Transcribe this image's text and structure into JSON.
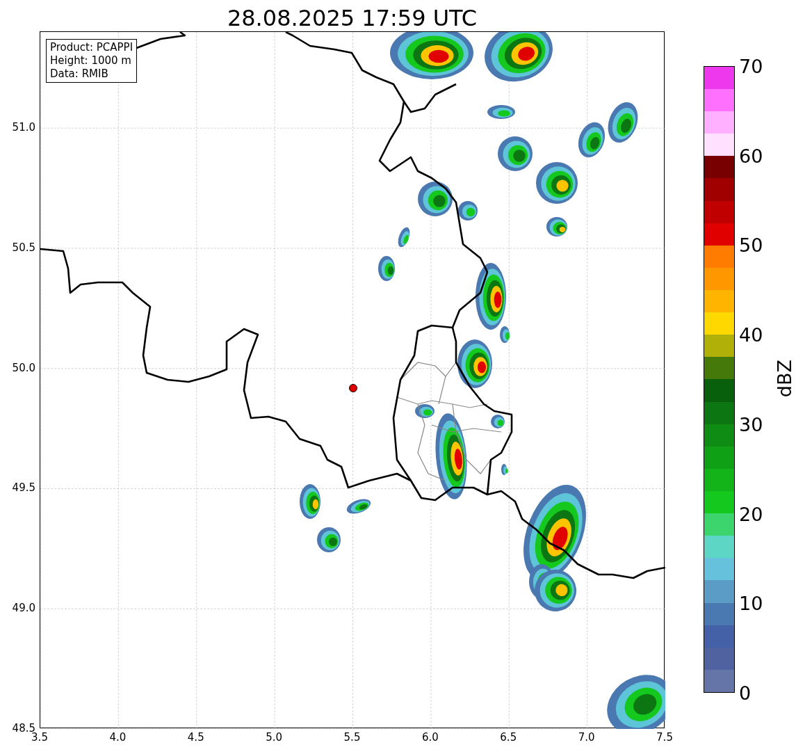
{
  "title": "28.08.2025 17:59 UTC",
  "info_box": [
    "Product: PCAPPI",
    "Height: 1000 m",
    "Data: RMIB"
  ],
  "map": {
    "xticks": [
      "3.5",
      "4.0",
      "4.5",
      "5.0",
      "5.5",
      "6.0",
      "6.5",
      "7.0",
      "7.5"
    ],
    "yticks": [
      "51.0",
      "50.5",
      "50.0",
      "49.5",
      "49.0",
      "48.5"
    ]
  },
  "colorbar": {
    "label": "dBZ",
    "ticks": [
      "70",
      "60",
      "50",
      "40",
      "30",
      "20",
      "10",
      "0"
    ],
    "bands": [
      {
        "color": "#6575a8"
      },
      {
        "color": "#5062a0"
      },
      {
        "color": "#4460a6"
      },
      {
        "color": "#4a78b0"
      },
      {
        "color": "#5a9cc6"
      },
      {
        "color": "#66c2dc"
      },
      {
        "color": "#5ed6c6"
      },
      {
        "color": "#3cd46c"
      },
      {
        "color": "#14c81e"
      },
      {
        "color": "#12b41a"
      },
      {
        "color": "#0fa016"
      },
      {
        "color": "#0e8c14"
      },
      {
        "color": "#0c7612"
      },
      {
        "color": "#08600c"
      },
      {
        "color": "#457a0a"
      },
      {
        "color": "#b0b008"
      },
      {
        "color": "#ffd800"
      },
      {
        "color": "#ffb400"
      },
      {
        "color": "#ff9800"
      },
      {
        "color": "#ff7c00"
      },
      {
        "color": "#e00000"
      },
      {
        "color": "#c00000"
      },
      {
        "color": "#a00000"
      },
      {
        "color": "#780000"
      },
      {
        "color": "#ffe0ff"
      },
      {
        "color": "#ffb0ff"
      },
      {
        "color": "#ff70ff"
      },
      {
        "color": "#ee38ee"
      }
    ]
  }
}
